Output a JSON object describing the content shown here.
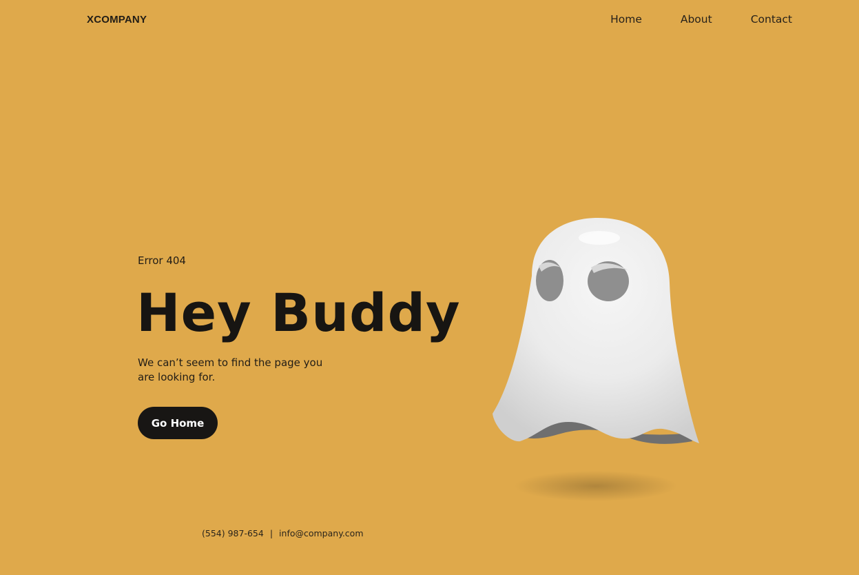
{
  "header": {
    "logo": "XCOMPANY",
    "nav": [
      {
        "label": "Home"
      },
      {
        "label": "About"
      },
      {
        "label": "Contact"
      }
    ]
  },
  "hero": {
    "error_code": "Error 404",
    "headline": "Hey Buddy",
    "subtitle": "We can’t seem to find the page you are looking for.",
    "button_label": "Go Home",
    "illustration": "ghost-illustration"
  },
  "footer": {
    "phone": "(554) 987-654",
    "separator": "|",
    "email": "info@company.com"
  },
  "colors": {
    "background": "#dfa94b",
    "text": "#171512",
    "button_bg": "#181614",
    "button_text": "#ffffff",
    "ghost_body": "#eeeeee"
  }
}
